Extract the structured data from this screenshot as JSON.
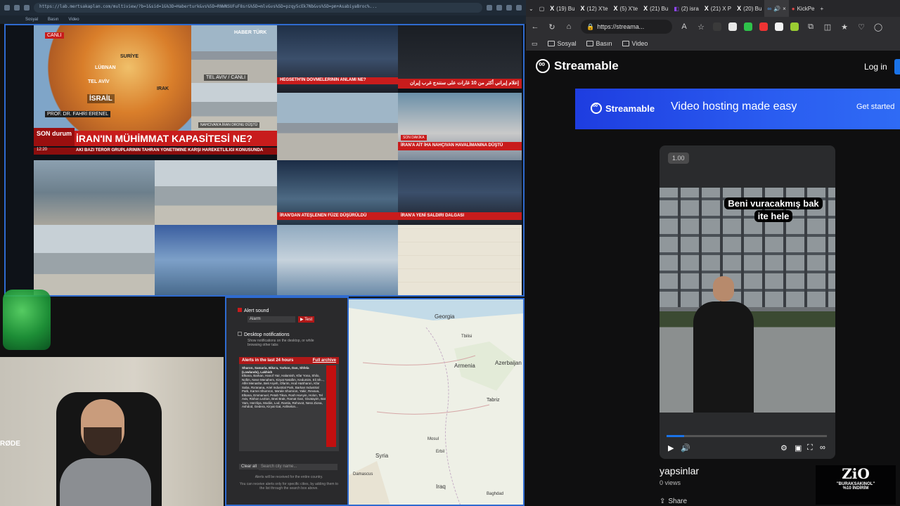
{
  "left_browser": {
    "url": "https://lab.mertsakaplan.com/multiview/?b=1&sid=1&%3D=Haberturk&vs%5D=RNWNSUFuF8sr&%5D=mlv&vs%5D=pzqy5cEk7Nb&vs%5D=pm+AsabiyaBroc%...",
    "bookmarks": [
      "Sosyal",
      "Basın",
      "Video"
    ],
    "tiles": {
      "haberturk_live": "CANLI",
      "haberturk_logo": "HABER TÜRK",
      "map_labels": [
        "SURİYE",
        "LÜBNAN",
        "TEL AVİV",
        "IRAK",
        "İSRAİL"
      ],
      "telaviv_caption": "TEL AVIV / CANLI",
      "iran_drone": "NAHCIVAN'A İRAN DRONU DÜŞTÜ",
      "guest_name": "PROF. DR. FAHRİ ERENEL",
      "son_durum": "SON durum",
      "main_headline": "İRAN'IN MÜHİMMAT KAPASİTESİ NE?",
      "ticker": "AKİ BAZI TERÖR GRUPLARININ TAHRAN YÖNETİMİNE KARŞI HAREKETLİLİĞİ KONUSUNDA",
      "time": "12:20",
      "hegseth": "HEGSETH'İN DÖVMELERİNİN ANLAMI NE?",
      "arabic_headline": "إعلام إيراني أكثر من 10 غارات على سنندج غرب إيران",
      "son_dakika_1": "SON DAKİKA",
      "nahcivan": "İRAN'A AİT İHA NAHÇIVAN HAVALİMANINA DÜŞTÜ",
      "iran_atesleme": "İRAN'DAN ATEŞLENEN FÜZE DÜŞÜRÜLDÜ",
      "iran_yeni": "İRAN'A YENİ SALDIRI DALGASI",
      "son_dakika_2": "SON DAKİKA"
    }
  },
  "alerts": {
    "alert_sound_label": "Alert sound",
    "alarm_option": "Alarm",
    "test_button": "▶ Test",
    "desktop_label": "Desktop notifications",
    "desktop_desc": "Show notifications on the desktop, or while browsing other tabs",
    "last24": "Alerts in the last 24 hours",
    "full_archive": "Full archive",
    "list_title": "Sharon, Samaria, Bika'a, Yarkon, Dan, Shfela (Lowlands), Lakhish",
    "list_text": "Elkana, Barkan, Hanof Yair, Halamish, Kfar Yona, Shilo, Nofim, Neve Menahem, Kiryat Netafim, Kedumim, Eli Sh..., Alfei Menashe, Beit Aryeh, Ofarim, Hod HaSharon, Kfar Saba, Ra'anana, Ariel Industrial Park, Barkan Industrial Park, Karnei Shomron, Ma'ale Shomron, Yakir, Revava, Elkana, Emmanuel, Petah Tikva, Rosh HaAyin, Holon, Tel Aviv, Rishon LeZion, Bnei Brak, Ramat Gan, Givatayim, Bat Yam, Herzliya, Modiin, Lod, Ramla, Rehovot, Ness Ziona, Ashdod, Gedera, Kiryat Gat, Ashkelon...",
    "clear_all": "Clear all",
    "search_placeholder": "Search city name...",
    "info1": "Alerts will be received for the entire country.",
    "info2": "You can receive alerts only for specific cities, by adding them to the list through the search box above."
  },
  "map": {
    "labels": [
      "Georgia",
      "Tbilisi",
      "Armenia",
      "Azerbaijan",
      "Tabriz",
      "Erbil",
      "Mosul",
      "Syria",
      "Damascus",
      "Iraq",
      "Baghdad"
    ]
  },
  "webcam": {
    "mic_brand": "RØDE"
  },
  "right_browser": {
    "tabs": [
      {
        "label": "(19) Bu",
        "icon": "x-icon"
      },
      {
        "label": "(12) X'te",
        "icon": "x-icon"
      },
      {
        "label": "(5) X'te",
        "icon": "x-icon"
      },
      {
        "label": "(21) Bu",
        "icon": "x-icon"
      },
      {
        "label": "(2) isra",
        "icon": "twitch-icon"
      },
      {
        "label": "(21) X P",
        "icon": "x-icon"
      },
      {
        "label": "(20) Bu",
        "icon": "x-icon"
      },
      {
        "label": "",
        "icon": "streamable-icon"
      },
      {
        "label": "KickPe",
        "icon": "kick-icon"
      }
    ],
    "url": "https://streama...",
    "bookmarks": [
      "Sosyal",
      "Basın",
      "Video"
    ]
  },
  "streamable": {
    "brand": "Streamable",
    "login": "Log in",
    "promo_brand": "Streamable",
    "promo_tagline": "Video hosting made easy",
    "promo_cta": "Get started",
    "speed": "1.00",
    "caption_line1": "Beni vuracakmış bak",
    "caption_line2": "ite hele",
    "progress_fraction": 0.11,
    "video_title": "yapsinlar",
    "views": "0 views",
    "share": "Share"
  },
  "overlay": {
    "logo": "ZiO",
    "line1": "\"BURAKSAKINOL\"",
    "line2": "%10 İNDİRİM"
  }
}
